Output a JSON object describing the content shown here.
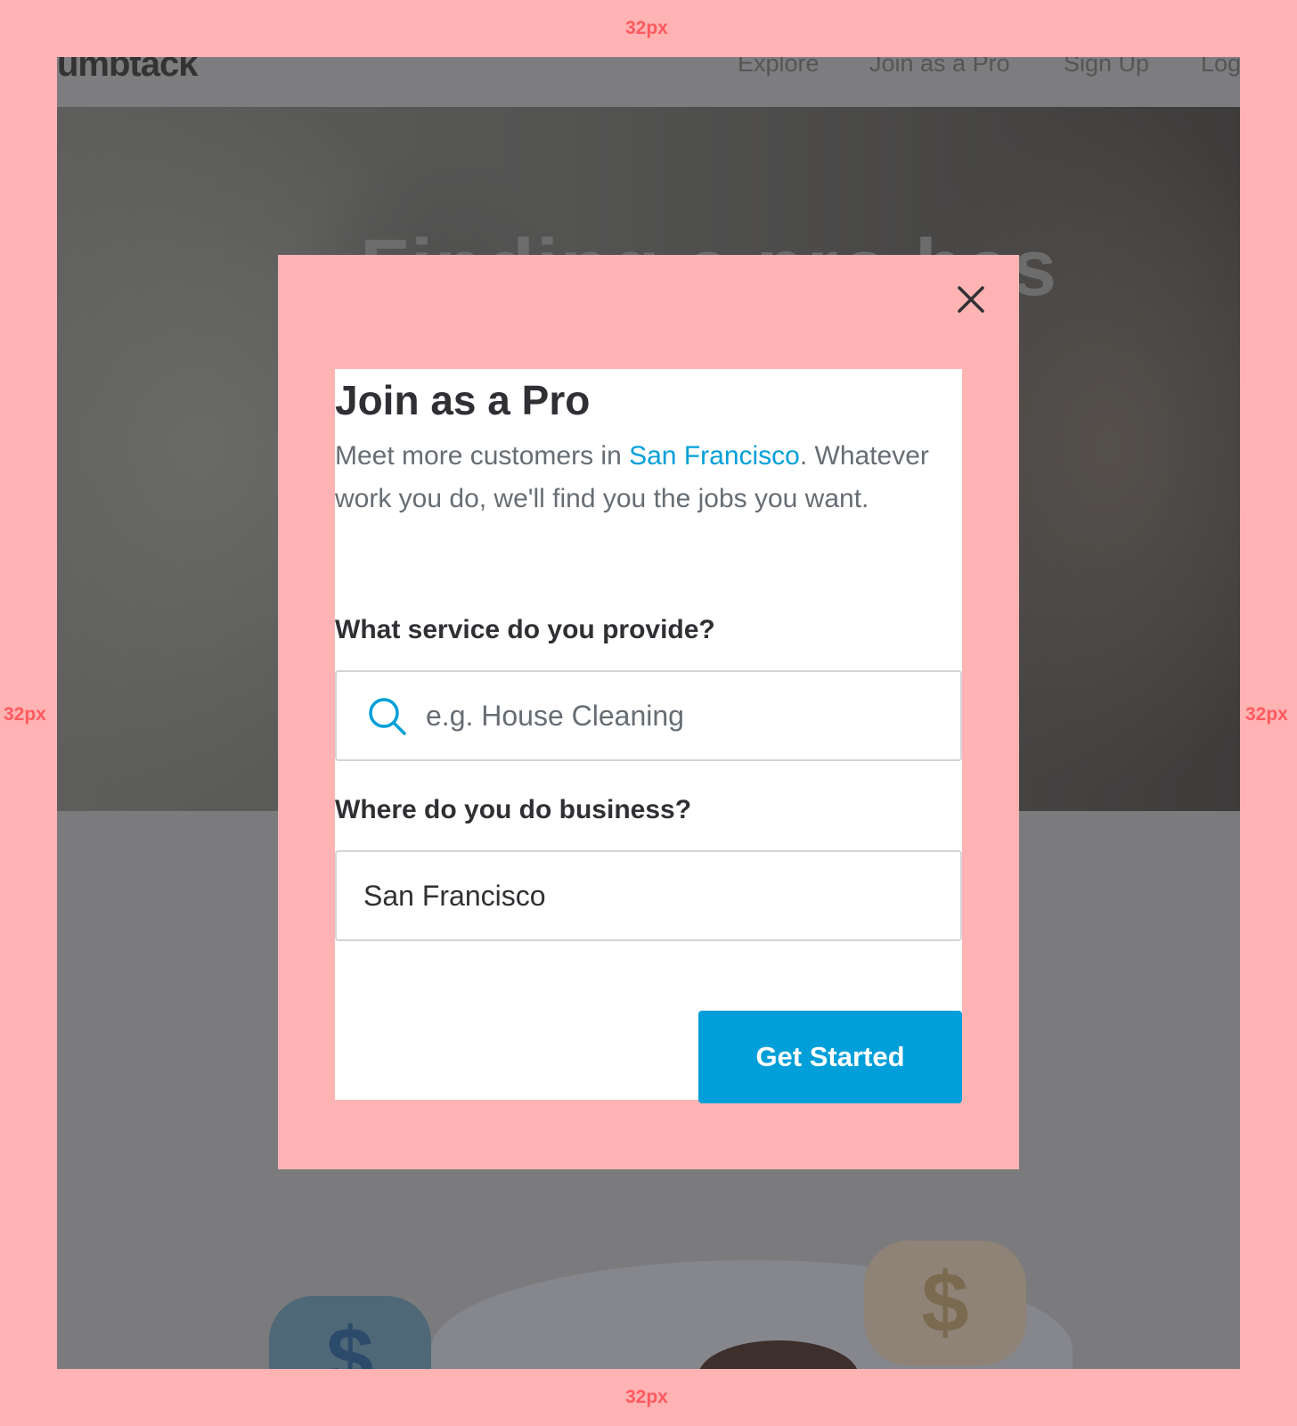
{
  "background_page": {
    "logo": "umbtack",
    "nav": [
      "Explore",
      "Join as a Pro",
      "Sign Up",
      "Log"
    ],
    "hero_title": "Finding a pro has",
    "bubble_symbol": "$"
  },
  "modal": {
    "title": "Join as a Pro",
    "desc_prefix": "Meet more customers in ",
    "desc_city": "San Francisco",
    "desc_suffix": ". Whatever work you do, we'll find you the jobs you want.",
    "service_label": "What service do you provide?",
    "service_placeholder": "e.g. House Cleaning",
    "location_label": "Where do you do business?",
    "location_value": "San Francisco",
    "cta_label": "Get Started",
    "close_icon": "close-icon",
    "search_icon": "search-icon"
  },
  "annotations": {
    "top_margin": "32px",
    "bottom_margin": "32px",
    "left_margin": "32px",
    "right_margin": "32px",
    "modal_top_padding": "64px",
    "modal_bottom_padding": "40px",
    "modal_side_padding": "32px"
  },
  "colors": {
    "accent": "#009fd9",
    "redline": "#ff5a5f",
    "redline_fill": "#ffb3b3",
    "text_primary": "#2f3033",
    "text_secondary": "#676d73"
  }
}
